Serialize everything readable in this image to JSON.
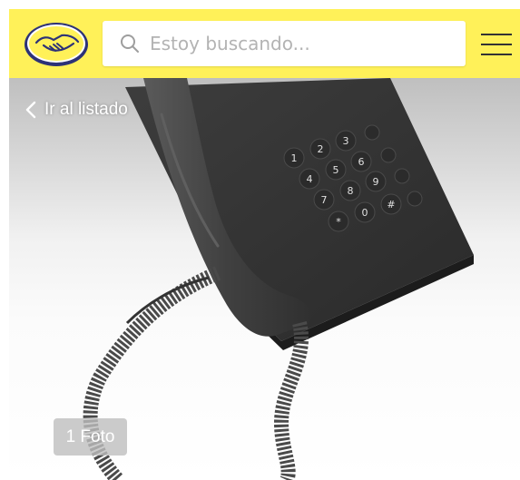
{
  "header": {
    "background_color": "#fff159",
    "logo_icon": "mercadolibre-handshake-logo",
    "search": {
      "placeholder": "Estoy buscando...",
      "value": ""
    },
    "menu_icon": "hamburger-menu-icon"
  },
  "gallery": {
    "back_label": "Ir al listado",
    "photo_count_label": "1 Foto",
    "image": "black-desk-telephone"
  }
}
